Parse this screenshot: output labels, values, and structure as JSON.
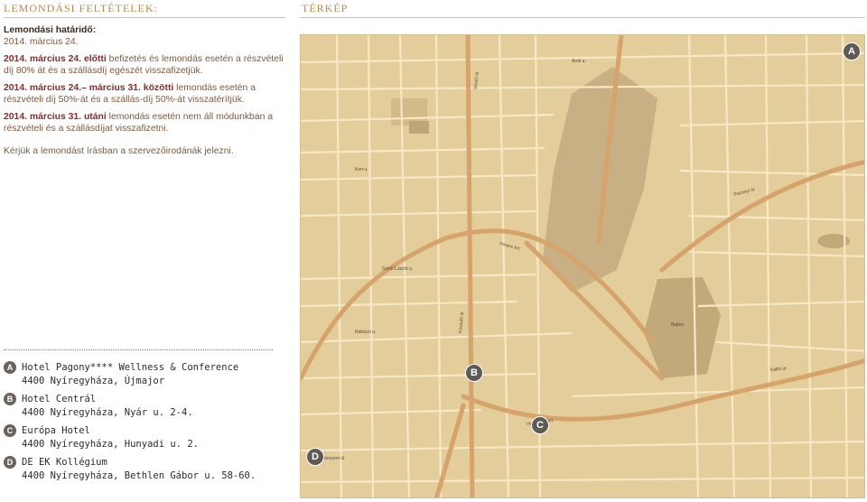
{
  "left": {
    "title": "LEMONDÁSI FELTÉTELEK:",
    "deadline_label": "Lemondási határidő:",
    "deadline_date": "2014. március 24.",
    "rules": [
      {
        "bold": "2014. március 24. előtti",
        "text": " befizetés és lemondás esetén a részvételi díj 80% át és a szállásdíj egészét visszafizetjük."
      },
      {
        "bold": "2014. március 24.– március 31. közötti",
        "text": " lemondás esetén a részvételi díj 50%-át és a szállás-díj 50%-át visszatérítjük."
      },
      {
        "bold": "2014. március 31. utáni",
        "text": " lemondás esetén nem áll módunkban a részvételi és a szállásdíjat visszafizetni."
      }
    ],
    "note": "Kérjük a lemondást írásban a szervezőirodánák jelezni."
  },
  "right": {
    "title": "TÉRKÉP"
  },
  "legend": [
    {
      "marker": "A",
      "name": "Hotel Pagony**** Wellness & Conference",
      "address": "4400 Nyíregyháza, Újmajor"
    },
    {
      "marker": "B",
      "name": "Hotel Centrál",
      "address": "4400 Nyíregyháza, Nyár u. 2-4."
    },
    {
      "marker": "C",
      "name": "Európa Hotel",
      "address": "4400 Nyíregyháza, Hunyadi u. 2."
    },
    {
      "marker": "D",
      "name": "DE EK Kollégium",
      "address": "4400 Nyíregyháza, Bethlen Gábor u. 58-60."
    }
  ],
  "map_pins": [
    "A",
    "B",
    "C",
    "D"
  ],
  "map_labels": {
    "l1": "Sóstói út",
    "l2": "Kossuth út",
    "l3": "Árok u.",
    "l4": "Kert u.",
    "l5": "Szent László u.",
    "l6": "Ferenc krt.",
    "l7": "Pazonyi út",
    "l8": "Vay Ádám krt.",
    "l9": "Debreceni út",
    "l10": "Rákóczi u.",
    "l11": "Bujtos",
    "l12": "Kállói út"
  },
  "colors": {
    "map_bg": "#e3cd9b",
    "road": "#f6e8c6",
    "main_road": "#d6a36a",
    "park": "#c8b084",
    "pin": "#5e5a57",
    "accent": "#b98a4a"
  }
}
